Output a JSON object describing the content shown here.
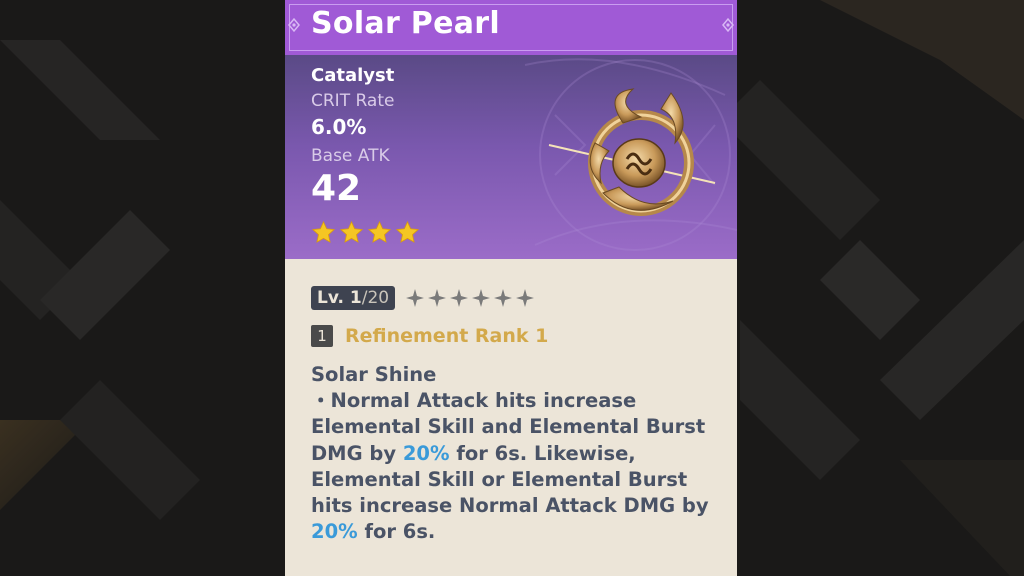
{
  "weapon": {
    "name": "Solar Pearl",
    "type": "Catalyst",
    "substat_label": "CRIT Rate",
    "substat_value": "6.0%",
    "base_atk_label": "Base ATK",
    "base_atk_value": "42",
    "rarity_stars": 4,
    "level_current": "Lv. 1",
    "level_max": "/20",
    "ascension_stars": 6,
    "refinement_number": "1",
    "refinement_label": "Refinement Rank 1"
  },
  "passive": {
    "name": "Solar Shine",
    "line1": "・Normal Attack hits increase Elemental Skill and Elemental Burst DMG by ",
    "value1": "20%",
    "line2": " for 6s. Likewise, Elemental Skill or Elemental Burst hits increase Normal Attack DMG by ",
    "value2": "20%",
    "line3": " for 6s."
  },
  "colors": {
    "title_bar": "#a05ad6",
    "card_body": "#ece5d8",
    "highlight": "#3a9ad9",
    "refinement": "#d3a94b",
    "star": "#f5c623"
  }
}
